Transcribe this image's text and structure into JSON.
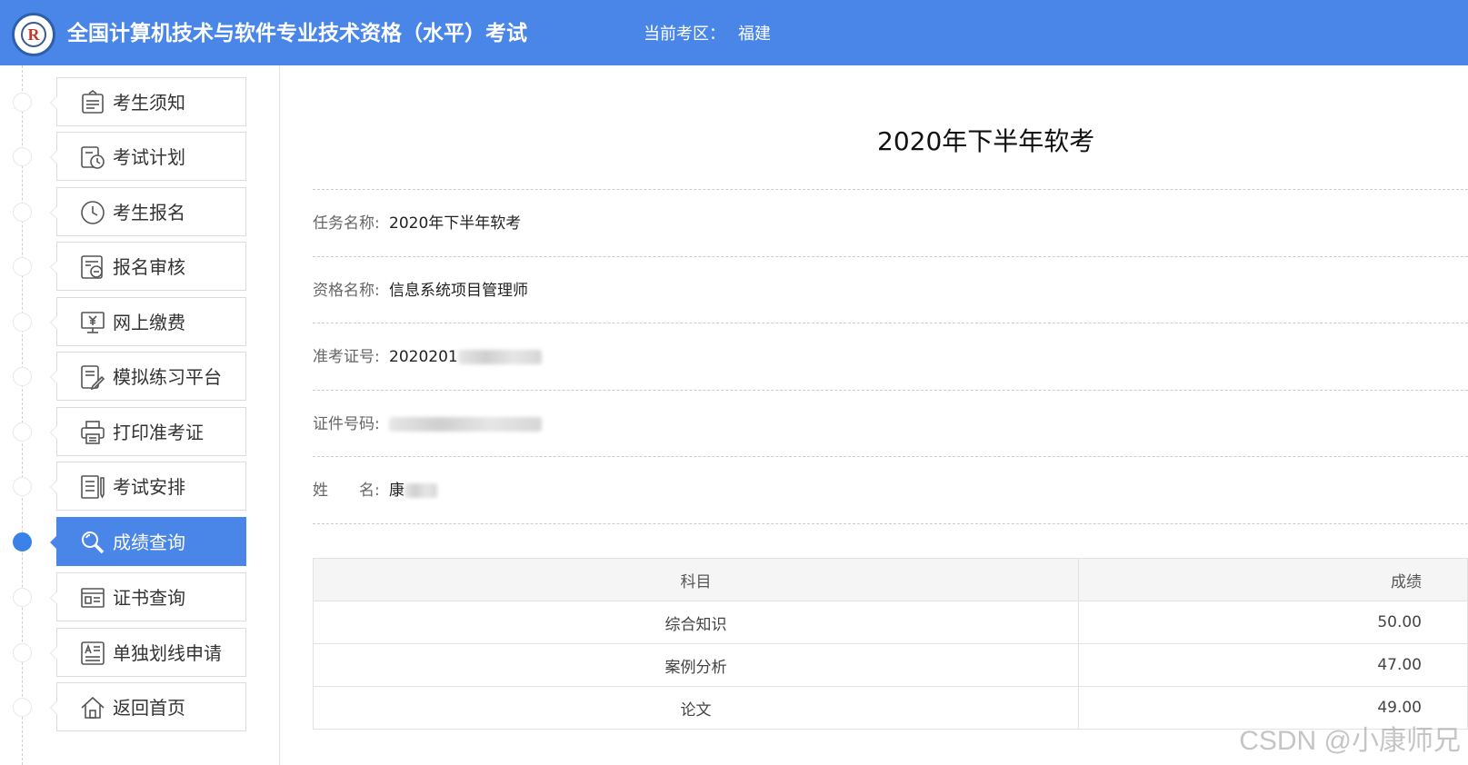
{
  "header": {
    "title": "全国计算机技术与软件专业技术资格（水平）考试",
    "region_label": "当前考区：",
    "region_value": "福建",
    "logo_letter": "R"
  },
  "sidebar": {
    "items": [
      {
        "label": "考生须知",
        "icon": "notice-icon"
      },
      {
        "label": "考试计划",
        "icon": "calendar-clock-icon"
      },
      {
        "label": "考生报名",
        "icon": "clock-icon"
      },
      {
        "label": "报名审核",
        "icon": "review-icon"
      },
      {
        "label": "网上缴费",
        "icon": "payment-icon"
      },
      {
        "label": "模拟练习平台",
        "icon": "practice-icon"
      },
      {
        "label": "打印准考证",
        "icon": "printer-icon"
      },
      {
        "label": "考试安排",
        "icon": "schedule-icon"
      },
      {
        "label": "成绩查询",
        "icon": "search-icon",
        "active": true
      },
      {
        "label": "证书查询",
        "icon": "certificate-icon"
      },
      {
        "label": "单独划线申请",
        "icon": "application-icon"
      },
      {
        "label": "返回首页",
        "icon": "home-icon"
      }
    ],
    "active_color": "#4a86e8"
  },
  "main": {
    "title": "2020年下半年软考",
    "info": {
      "task_label": "任务名称:",
      "task_value": "2020年下半年软考",
      "qual_label": "资格名称:",
      "qual_value": "信息系统项目管理师",
      "ticket_label": "准考证号:",
      "ticket_value": "2020201",
      "id_label": "证件号码:",
      "id_value": "",
      "name_label": "姓　　名:",
      "name_value": "康"
    },
    "table": {
      "headers": [
        "科目",
        "成绩"
      ],
      "rows": [
        {
          "subject": "综合知识",
          "score": "50.00"
        },
        {
          "subject": "案例分析",
          "score": "47.00"
        },
        {
          "subject": "论文",
          "score": "49.00"
        }
      ]
    }
  },
  "watermark": "CSDN @小康师兄",
  "colors": {
    "header_bg": "#4a86e8",
    "active_bg": "#4a86e8",
    "active_dot": "#3a82e8"
  }
}
